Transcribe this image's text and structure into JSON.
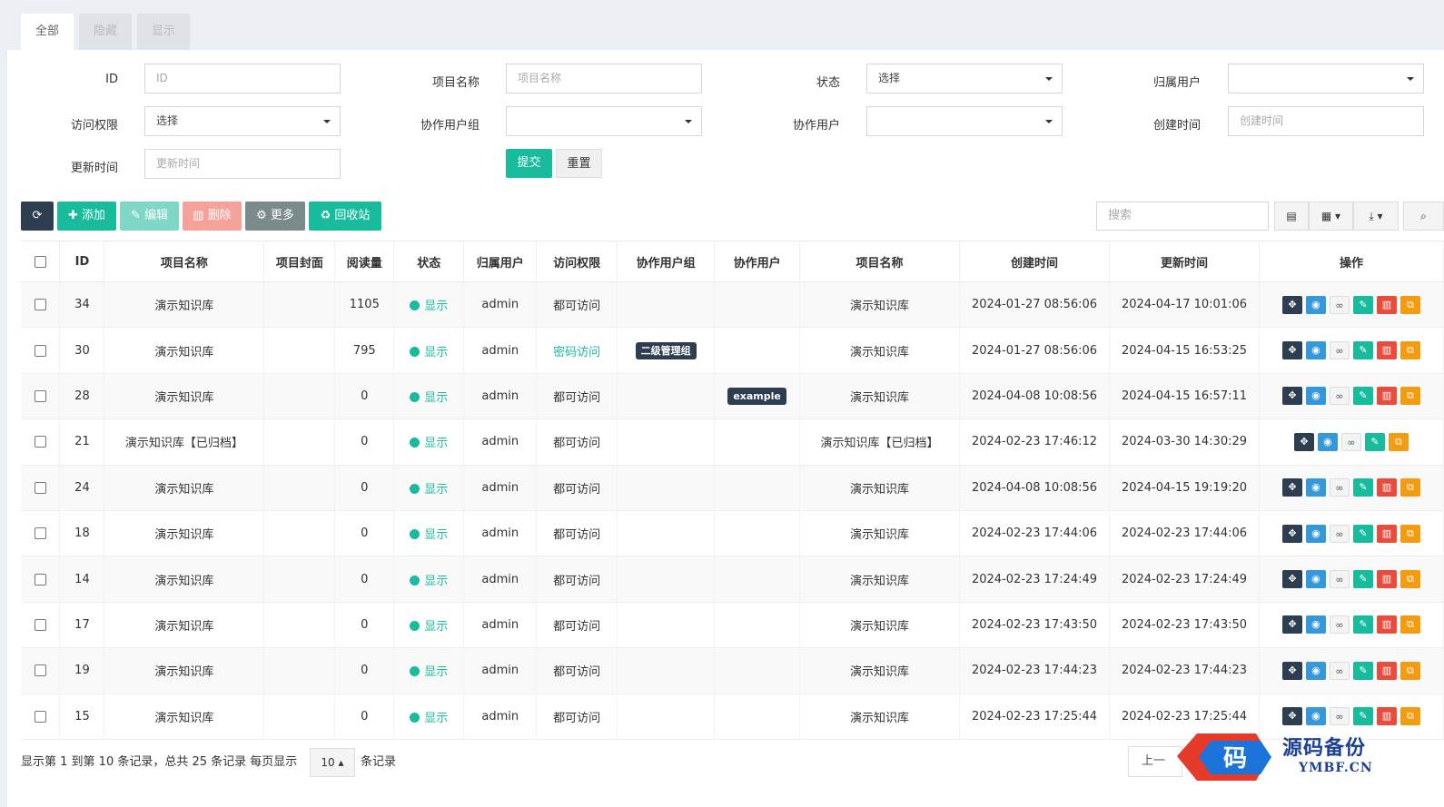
{
  "tabs": [
    {
      "label": "全部",
      "active": true
    },
    {
      "label": "隐藏",
      "active": false
    },
    {
      "label": "显示",
      "active": false
    }
  ],
  "filters": {
    "id_label": "ID",
    "id_placeholder": "ID",
    "name_label": "项目名称",
    "name_placeholder": "项目名称",
    "status_label": "状态",
    "status_value": "选择",
    "owner_label": "归属用户",
    "owner_value": "",
    "perm_label": "访问权限",
    "perm_value": "选择",
    "cogroup_label": "协作用户组",
    "cogroup_value": "",
    "couser_label": "协作用户",
    "couser_value": "",
    "created_label": "创建时间",
    "created_placeholder": "创建时间",
    "updated_label": "更新时间",
    "updated_placeholder": "更新时间",
    "submit": "提交",
    "reset": "重置"
  },
  "toolbar": {
    "refresh_icon": "refresh-icon",
    "add": "添加",
    "edit": "编辑",
    "delete": "删除",
    "more": "更多",
    "recycle": "回收站",
    "search_placeholder": "搜索"
  },
  "columns": [
    "ID",
    "项目名称",
    "项目封面",
    "阅读量",
    "状态",
    "归属用户",
    "访问权限",
    "协作用户组",
    "协作用户",
    "项目名称",
    "创建时间",
    "更新时间",
    "操作"
  ],
  "rows": [
    {
      "id": "34",
      "name": "演示知识库",
      "reads": "1105",
      "status": "显示",
      "owner": "admin",
      "perm": "都可访问",
      "perm_green": false,
      "group": "",
      "user": "",
      "name2": "演示知识库",
      "created": "2024-01-27 08:56:06",
      "updated": "2024-04-17 10:01:06",
      "ops": 6
    },
    {
      "id": "30",
      "name": "演示知识库",
      "reads": "795",
      "status": "显示",
      "owner": "admin",
      "perm": "密码访问",
      "perm_green": true,
      "group": "二级管理组",
      "user": "",
      "name2": "演示知识库",
      "created": "2024-01-27 08:56:06",
      "updated": "2024-04-15 16:53:25",
      "ops": 6
    },
    {
      "id": "28",
      "name": "演示知识库",
      "reads": "0",
      "status": "显示",
      "owner": "admin",
      "perm": "都可访问",
      "perm_green": false,
      "group": "",
      "user": "example",
      "name2": "演示知识库",
      "created": "2024-04-08 10:08:56",
      "updated": "2024-04-15 16:57:11",
      "ops": 6
    },
    {
      "id": "21",
      "name": "演示知识库【已归档】",
      "reads": "0",
      "status": "显示",
      "owner": "admin",
      "perm": "都可访问",
      "perm_green": false,
      "group": "",
      "user": "",
      "name2": "演示知识库【已归档】",
      "created": "2024-02-23 17:46:12",
      "updated": "2024-03-30 14:30:29",
      "ops": 5
    },
    {
      "id": "24",
      "name": "演示知识库",
      "reads": "0",
      "status": "显示",
      "owner": "admin",
      "perm": "都可访问",
      "perm_green": false,
      "group": "",
      "user": "",
      "name2": "演示知识库",
      "created": "2024-04-08 10:08:56",
      "updated": "2024-04-15 19:19:20",
      "ops": 6
    },
    {
      "id": "18",
      "name": "演示知识库",
      "reads": "0",
      "status": "显示",
      "owner": "admin",
      "perm": "都可访问",
      "perm_green": false,
      "group": "",
      "user": "",
      "name2": "演示知识库",
      "created": "2024-02-23 17:44:06",
      "updated": "2024-02-23 17:44:06",
      "ops": 6
    },
    {
      "id": "14",
      "name": "演示知识库",
      "reads": "0",
      "status": "显示",
      "owner": "admin",
      "perm": "都可访问",
      "perm_green": false,
      "group": "",
      "user": "",
      "name2": "演示知识库",
      "created": "2024-02-23 17:24:49",
      "updated": "2024-02-23 17:24:49",
      "ops": 6
    },
    {
      "id": "17",
      "name": "演示知识库",
      "reads": "0",
      "status": "显示",
      "owner": "admin",
      "perm": "都可访问",
      "perm_green": false,
      "group": "",
      "user": "",
      "name2": "演示知识库",
      "created": "2024-02-23 17:43:50",
      "updated": "2024-02-23 17:43:50",
      "ops": 6
    },
    {
      "id": "19",
      "name": "演示知识库",
      "reads": "0",
      "status": "显示",
      "owner": "admin",
      "perm": "都可访问",
      "perm_green": false,
      "group": "",
      "user": "",
      "name2": "演示知识库",
      "created": "2024-02-23 17:44:23",
      "updated": "2024-02-23 17:44:23",
      "ops": 6
    },
    {
      "id": "15",
      "name": "演示知识库",
      "reads": "0",
      "status": "显示",
      "owner": "admin",
      "perm": "都可访问",
      "perm_green": false,
      "group": "",
      "user": "",
      "name2": "演示知识库",
      "created": "2024-02-23 17:25:44",
      "updated": "2024-02-23 17:25:44",
      "ops": 6
    }
  ],
  "pagination": {
    "summary": "显示第 1 到第 10 条记录，总共 25 条记录 每页显示",
    "page_size": "10",
    "suffix": "条记录",
    "prev": "上一"
  },
  "watermark": {
    "logo_char": "码",
    "title": "源码备份",
    "sub": "YMBF.CN"
  },
  "colors": {
    "primary": "#18bc9c",
    "dark": "#2c3e50",
    "info": "#3498db",
    "danger": "#e74c3c",
    "warning": "#f39c12"
  }
}
